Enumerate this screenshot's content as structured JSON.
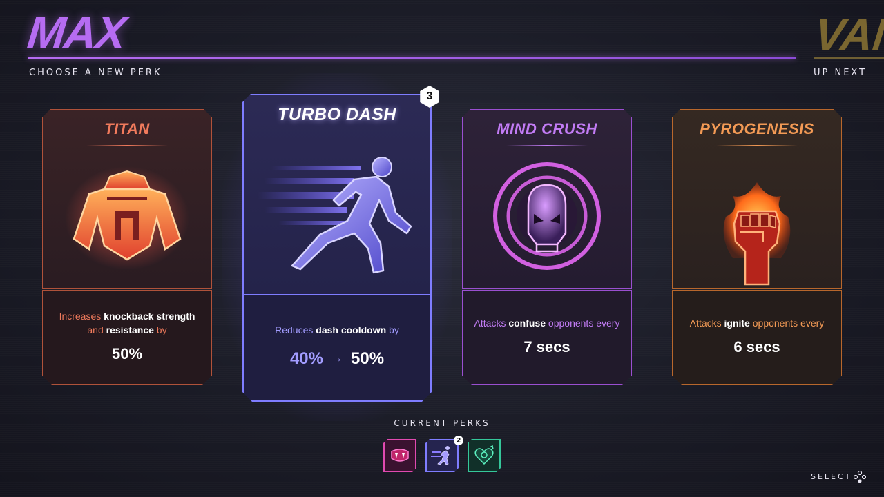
{
  "header": {
    "player_name": "MAX",
    "subtitle": "CHOOSE A NEW PERK",
    "next_player_name": "VAN",
    "next_label": "UP NEXT"
  },
  "cards": [
    {
      "title": "TITAN",
      "desc_parts": [
        "Increases ",
        "knockback strength",
        " and ",
        "resistance",
        " by"
      ],
      "value": "50%",
      "icon": "titan-armor-icon",
      "color": "#f07a5c"
    },
    {
      "title": "TURBO DASH",
      "desc_parts": [
        "Reduces ",
        "dash cooldown",
        " by"
      ],
      "value_from": "40%",
      "value_arrow": "→",
      "value_to": "50%",
      "rank": "3",
      "icon": "running-figure-icon",
      "color": "#7f7dff",
      "selected": true
    },
    {
      "title": "MIND CRUSH",
      "desc_parts": [
        "Attacks ",
        "confuse",
        " opponents every"
      ],
      "value": "7 secs",
      "icon": "mind-head-icon",
      "color": "#c27cf5"
    },
    {
      "title": "PYROGENESIS",
      "desc_parts": [
        "Attacks ",
        "ignite",
        " opponents every"
      ],
      "value": "6 secs",
      "icon": "flaming-fist-icon",
      "color": "#f39a55"
    }
  ],
  "current_perks": {
    "label": "CURRENT PERKS",
    "items": [
      {
        "icon": "fangs-icon",
        "color": "#e04ab0"
      },
      {
        "icon": "running-figure-icon",
        "color": "#7f7dff",
        "badge": "2"
      },
      {
        "icon": "heart-gadget-icon",
        "color": "#35c79a"
      }
    ]
  },
  "footer": {
    "select_label": "SELECT",
    "select_icon": "controller-buttons-icon"
  }
}
